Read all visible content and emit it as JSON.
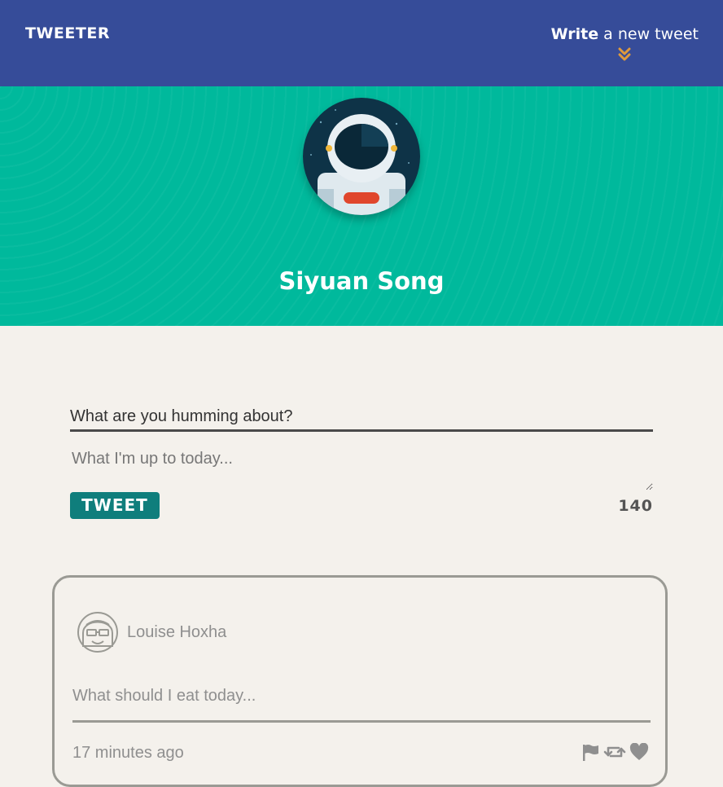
{
  "nav": {
    "brand": "TWEETER",
    "compose_bold": "Write",
    "compose_rest": " a new tweet",
    "compose_icon": "chevron-double-down-icon",
    "accent_color": "#e09a3c"
  },
  "profile": {
    "name": "Siyuan Song",
    "avatar": "astronaut-avatar"
  },
  "composer": {
    "title": "What are you humming about?",
    "textarea_value": "",
    "placeholder": "What I'm up to today...",
    "submit_label": "TWEET",
    "char_counter": "140"
  },
  "tweets": [
    {
      "avatar": "user-avatar-icon",
      "author": "Louise Hoxha",
      "text": "What should I eat today...",
      "time": "17 minutes ago",
      "actions": [
        "flag-icon",
        "retweet-icon",
        "heart-icon"
      ]
    }
  ],
  "colors": {
    "nav_bg": "#364c99",
    "hero_bg": "#00b99c",
    "page_bg": "#f4f1ec",
    "button_bg": "#0f7e7c"
  }
}
